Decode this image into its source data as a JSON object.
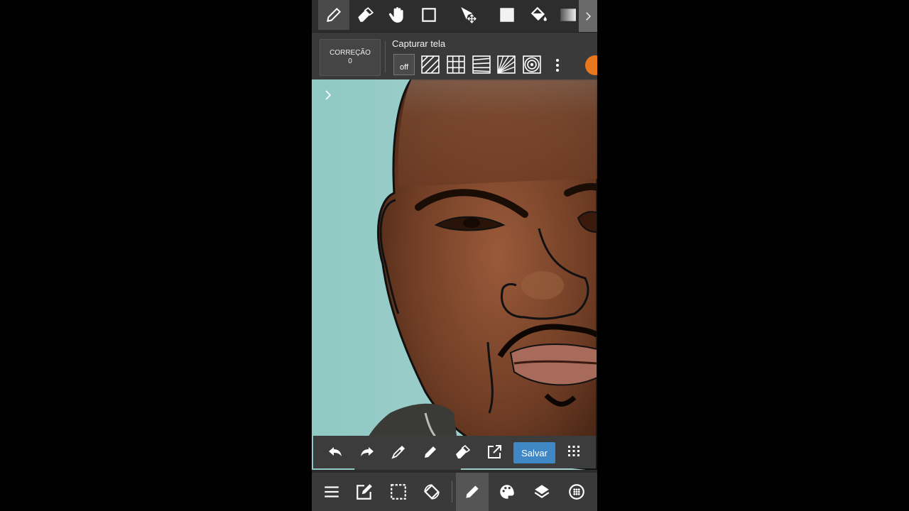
{
  "app": {
    "correction_label": "CORREÇÃO",
    "correction_value": "0",
    "snap_title": "Capturar tela",
    "snap_off_label": "off",
    "save_label": "Salvar"
  },
  "top_tools": [
    "pen-icon",
    "eraser-icon",
    "hand-icon",
    "rectangle-icon",
    "move-icon",
    "fill-color-icon",
    "bucket-icon",
    "gradient-icon"
  ],
  "snap_modes": [
    "off",
    "parallel",
    "grid",
    "horizontal",
    "perspective",
    "concentric"
  ],
  "bottom_tools": [
    "undo-icon",
    "redo-icon",
    "eyedropper-icon",
    "pen-icon",
    "eraser-icon",
    "export-icon",
    "save-button",
    "grid-icon"
  ],
  "nav_tools": [
    "menu-icon",
    "edit-icon",
    "selection-icon",
    "rotate-icon",
    "brush-icon",
    "palette-icon",
    "layers-icon",
    "globe-icon"
  ],
  "colors": {
    "accent": "#3f88c5",
    "orange": "#e8771e",
    "toolbar": "#2d2d2d",
    "subbar": "#3a3a3a"
  }
}
